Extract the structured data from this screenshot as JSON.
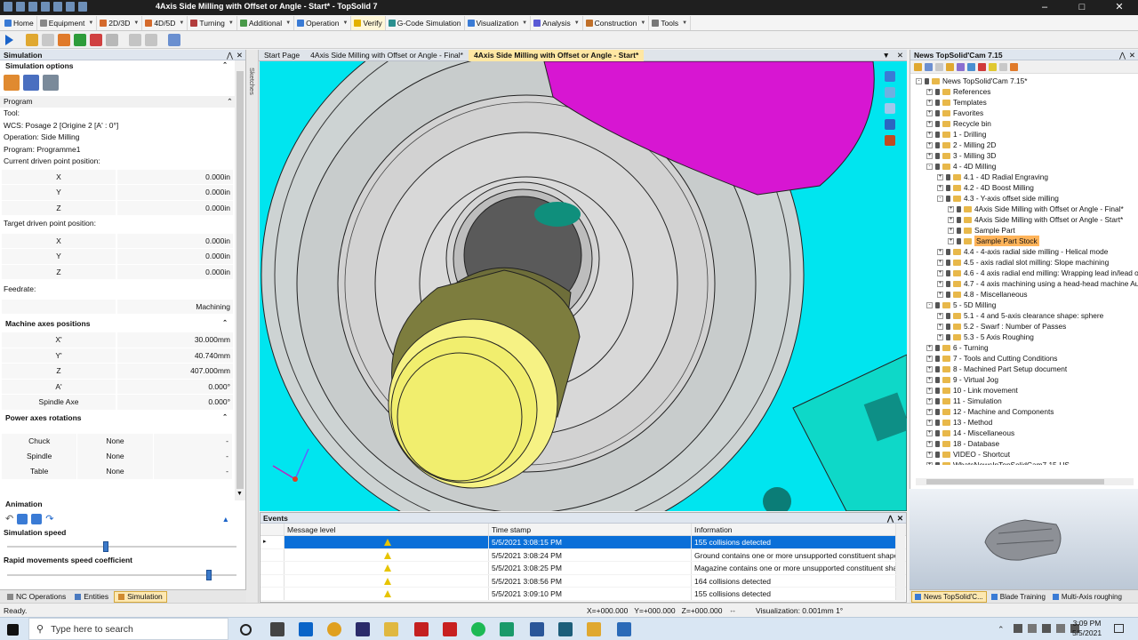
{
  "window": {
    "title": "4Axis Side Milling with Offset or Angle - Start* - TopSolid 7"
  },
  "menubar": {
    "items": [
      {
        "label": "Home"
      },
      {
        "label": "Equipment"
      },
      {
        "label": "2D/3D"
      },
      {
        "label": "4D/5D"
      },
      {
        "label": "Turning"
      },
      {
        "label": "Additional"
      },
      {
        "label": "Operation"
      },
      {
        "label": "Verify"
      },
      {
        "label": "G-Code Simulation"
      },
      {
        "label": "Visualization"
      },
      {
        "label": "Analysis"
      },
      {
        "label": "Construction"
      },
      {
        "label": "Tools"
      }
    ]
  },
  "left": {
    "header": "Simulation",
    "options_title": "Simulation options",
    "program_section": "Program",
    "tool_label": "Tool:",
    "wcs": "WCS: Posage 2 [Origine 2 [A' : 0°]",
    "operation": "Operation: Side Milling",
    "program": "Program: Programme1",
    "current_label": "Current driven point position:",
    "current": [
      {
        "k": "X",
        "v": "0.000in"
      },
      {
        "k": "Y",
        "v": "0.000in"
      },
      {
        "k": "Z",
        "v": "0.000in"
      }
    ],
    "target_label": "Target driven point position:",
    "target": [
      {
        "k": "X",
        "v": "0.000in"
      },
      {
        "k": "Y",
        "v": "0.000in"
      },
      {
        "k": "Z",
        "v": "0.000in"
      }
    ],
    "feedrate_label": "Feedrate:",
    "feedrate_value": "Machining",
    "machine_axes_section": "Machine axes positions",
    "machine_axes": [
      {
        "k": "X'",
        "v": "30.000mm"
      },
      {
        "k": "Y'",
        "v": "40.740mm"
      },
      {
        "k": "Z",
        "v": "407.000mm"
      },
      {
        "k": "A'",
        "v": "0.000°"
      },
      {
        "k": "Spindle Axe",
        "v": "0.000°"
      }
    ],
    "power_section": "Power axes rotations",
    "power": [
      {
        "a": "Chuck",
        "b": "None",
        "c": "-"
      },
      {
        "a": "Spindle",
        "b": "None",
        "c": "-"
      },
      {
        "a": "Table",
        "b": "None",
        "c": "-"
      }
    ],
    "animation_label": "Animation",
    "sim_speed_label": "Simulation speed",
    "sim_speed_value": 0.43,
    "rapid_label": "Rapid movements speed coefficient",
    "rapid_value": 0.88,
    "tabs": [
      {
        "label": "NC Operations"
      },
      {
        "label": "Entities"
      },
      {
        "label": "Simulation"
      }
    ]
  },
  "strip_label": "Sketches",
  "doctabs": [
    {
      "label": "Start Page"
    },
    {
      "label": "4Axis Side Milling with Offset or Angle - Final*"
    },
    {
      "label": "4Axis Side Milling with Offset or Angle - Start*"
    }
  ],
  "events": {
    "title": "Events",
    "columns": [
      "Message level",
      "Time stamp",
      "Information"
    ],
    "rows": [
      {
        "time": "5/5/2021 3:08:15 PM",
        "info": "155 collisions detected"
      },
      {
        "time": "5/5/2021 3:08:24 PM",
        "info": "Ground contains one or more unsupported constituent shapes"
      },
      {
        "time": "5/5/2021 3:08:25 PM",
        "info": "Magazine contains one or more unsupported constituent sha..."
      },
      {
        "time": "5/5/2021 3:08:56 PM",
        "info": "164 collisions detected"
      },
      {
        "time": "5/5/2021 3:09:10 PM",
        "info": "155 collisions detected"
      }
    ]
  },
  "right": {
    "header": "News TopSolid'Cam 7.15",
    "tree": [
      {
        "label": "News TopSolid'Cam 7.15*",
        "lvl": 0,
        "exp": "-"
      },
      {
        "label": "References",
        "lvl": 1,
        "exp": "+"
      },
      {
        "label": "Templates",
        "lvl": 1,
        "exp": "+"
      },
      {
        "label": "Favorites",
        "lvl": 1,
        "exp": "+"
      },
      {
        "label": "Recycle bin",
        "lvl": 1,
        "exp": "+"
      },
      {
        "label": "1 - Drilling",
        "lvl": 1,
        "exp": "+"
      },
      {
        "label": "2 - Milling 2D",
        "lvl": 1,
        "exp": "+"
      },
      {
        "label": "3 - Milling 3D",
        "lvl": 1,
        "exp": "+"
      },
      {
        "label": "4 - 4D Milling",
        "lvl": 1,
        "exp": "-"
      },
      {
        "label": "4.1 - 4D Radial Engraving",
        "lvl": 2,
        "exp": "+"
      },
      {
        "label": "4.2 - 4D Boost Milling",
        "lvl": 2,
        "exp": "+"
      },
      {
        "label": "4.3 - Y-axis offset side milling",
        "lvl": 2,
        "exp": "-"
      },
      {
        "label": "4Axis Side Milling with Offset or Angle - Final*",
        "lvl": 3,
        "exp": "+"
      },
      {
        "label": "4Axis Side Milling with Offset or Angle - Start*",
        "lvl": 3,
        "exp": "+"
      },
      {
        "label": "Sample Part",
        "lvl": 3,
        "exp": "+"
      },
      {
        "label": "Sample Part Stock",
        "lvl": 3,
        "exp": "+",
        "hl": true
      },
      {
        "label": "4.4 - 4-axis radial side milling - Helical mode",
        "lvl": 2,
        "exp": "+"
      },
      {
        "label": "4.5 - axis radial slot milling: Slope machining",
        "lvl": 2,
        "exp": "+"
      },
      {
        "label": "4.6 - 4 axis radial end milling: Wrapping lead in/lead out p",
        "lvl": 2,
        "exp": "+"
      },
      {
        "label": "4.7 - 4 axis machining using a head-head machine Autom",
        "lvl": 2,
        "exp": "+"
      },
      {
        "label": "4.8 - Miscellaneous",
        "lvl": 2,
        "exp": "+"
      },
      {
        "label": "5 - 5D Milling",
        "lvl": 1,
        "exp": "-"
      },
      {
        "label": "5.1 - 4 and 5-axis clearance shape: sphere",
        "lvl": 2,
        "exp": "+"
      },
      {
        "label": "5.2 - Swarf : Number of Passes",
        "lvl": 2,
        "exp": "+"
      },
      {
        "label": "5.3 - 5 Axis Roughing",
        "lvl": 2,
        "exp": "+"
      },
      {
        "label": "6 - Turning",
        "lvl": 1,
        "exp": "+"
      },
      {
        "label": "7 - Tools and Cutting Conditions",
        "lvl": 1,
        "exp": "+"
      },
      {
        "label": "8 - Machined Part Setup document",
        "lvl": 1,
        "exp": "+"
      },
      {
        "label": "9 - Virtual Jog",
        "lvl": 1,
        "exp": "+"
      },
      {
        "label": "10 - Link movement",
        "lvl": 1,
        "exp": "+"
      },
      {
        "label": "11 - Simulation",
        "lvl": 1,
        "exp": "+"
      },
      {
        "label": "12 - Machine and Components",
        "lvl": 1,
        "exp": "+"
      },
      {
        "label": "13 - Method",
        "lvl": 1,
        "exp": "+"
      },
      {
        "label": "14 - Miscellaneous",
        "lvl": 1,
        "exp": "+"
      },
      {
        "label": "18 - Database",
        "lvl": 1,
        "exp": "+"
      },
      {
        "label": "VIDEO - Shortcut",
        "lvl": 1,
        "exp": "+"
      },
      {
        "label": "WhatsNewsInTopSolidCam7.15-US",
        "lvl": 1,
        "exp": "+"
      }
    ],
    "tabs": [
      {
        "label": "News TopSolid'C..."
      },
      {
        "label": "Blade Training"
      },
      {
        "label": "Multi-Axis roughing"
      }
    ]
  },
  "status": {
    "ready": "Ready.",
    "coords": "X=+000.000   Y=+000.000   Z=+000.000",
    "visualization": "Visualization: 0.001mm 1°"
  },
  "taskbar": {
    "search_placeholder": "Type here to search",
    "time": "3:09 PM",
    "date": "5/5/2021"
  }
}
